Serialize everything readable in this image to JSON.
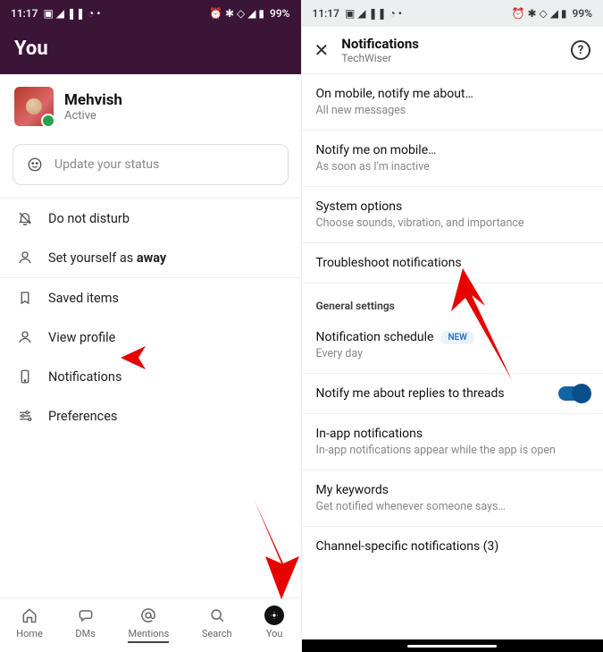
{
  "status_bar": {
    "time": "11:17",
    "left_glyphs": "▣ ◢ ❚❚ ◔ •",
    "right_glyphs": "⏰ ✱ ◇ ◢ ▮",
    "battery": "99%"
  },
  "left": {
    "header_title": "You",
    "profile": {
      "name": "Mehvish",
      "status": "Active"
    },
    "status_input_placeholder": "Update your status",
    "menu": {
      "dnd": "Do not disturb",
      "away_prefix": "Set yourself as ",
      "away_bold": "away",
      "saved": "Saved items",
      "view_profile": "View profile",
      "notifications": "Notifications",
      "preferences": "Preferences"
    },
    "nav": {
      "home": "Home",
      "dms": "DMs",
      "mentions": "Mentions",
      "search": "Search",
      "you": "You"
    }
  },
  "right": {
    "header": {
      "title": "Notifications",
      "subtitle": "TechWiser"
    },
    "items": {
      "mobile_notify": {
        "title": "On mobile, notify me about…",
        "sub": "All new messages"
      },
      "notify_on_mobile": {
        "title": "Notify me on mobile…",
        "sub": "As soon as I'm inactive"
      },
      "system_options": {
        "title": "System options",
        "sub": "Choose sounds, vibration, and importance"
      },
      "troubleshoot": {
        "title": "Troubleshoot notifications"
      },
      "section_general": "General settings",
      "schedule": {
        "title": "Notification schedule",
        "badge": "NEW",
        "sub": "Every day"
      },
      "threads": {
        "title": "Notify me about replies to threads"
      },
      "in_app": {
        "title": "In-app notifications",
        "sub": "In-app notifications appear while the app is open"
      },
      "keywords": {
        "title": "My keywords",
        "sub": "Get notified whenever someone says…"
      },
      "channel_specific": {
        "title": "Channel-specific notifications (3)"
      }
    }
  }
}
